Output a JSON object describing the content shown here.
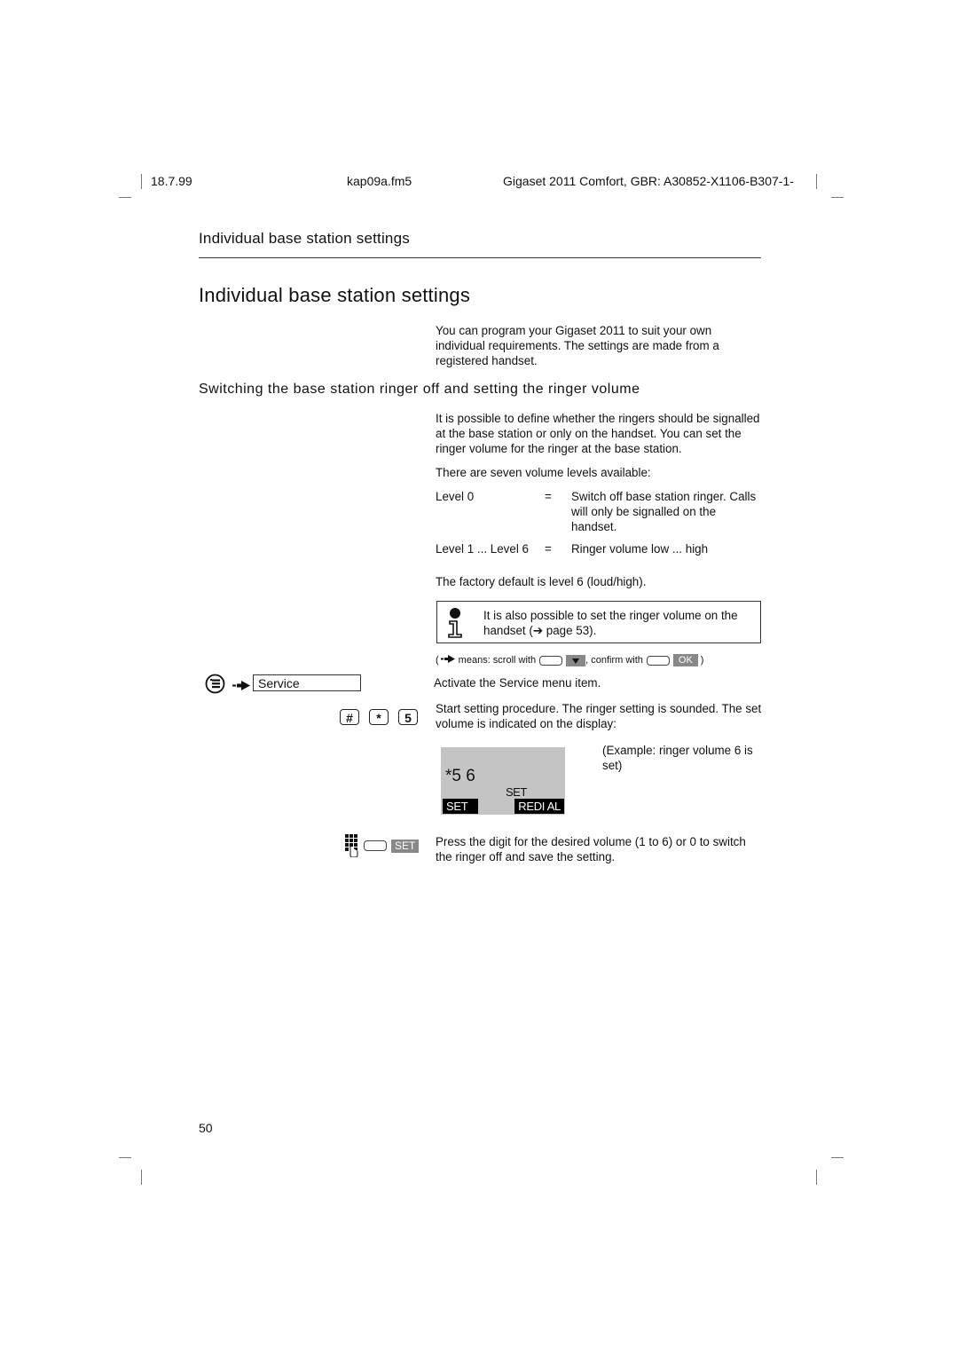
{
  "header": {
    "date": "18.7.99",
    "file": "kap09a.fm5",
    "product": "Gigaset 2011 Comfort, GBR: A30852-X1106-B307-1-"
  },
  "running_title": "Individual base station settings",
  "section_title": "Individual base station settings",
  "intro": "You can program your Gigaset 2011 to suit your own individual requirements. The settings are made from a registered handset.",
  "subsection_title": "Switching the base station ringer off and setting the ringer volume",
  "subsection_intro": "It is possible to define whether the ringers should be signalled at the base station or only on the handset. You can set the ringer volume for the ringer at the base station.",
  "levels_intro": "There are seven volume levels available:",
  "levels": [
    {
      "key": "Level 0",
      "eq": "=",
      "value": "Switch off base station ringer. Calls will only be signalled on the handset."
    },
    {
      "key": "Level 1 ... Level 6",
      "eq": "=",
      "value": "Ringer volume low ... high"
    }
  ],
  "factory_default": "The factory default is level 6 (loud/high).",
  "note": {
    "icon": "info-icon",
    "text": "It is also possible to set the ringer volume on the handset (➔ page 53)."
  },
  "legend": {
    "open_paren": "(",
    "means": "means: scroll with",
    "confirm": ", confirm with",
    "ok_label": "OK",
    "close_paren": ")"
  },
  "steps": [
    {
      "keys": [
        "menu-key-icon",
        "arrow-icon"
      ],
      "menu_item": "Service",
      "text": "Activate the Service menu item."
    },
    {
      "keys": [
        "#",
        "*",
        "5"
      ],
      "text": "Start setting procedure. The ringer setting is sounded. The set volume is indicated on the display:"
    },
    {
      "keys": [
        "keypad-icon",
        "softkey-blank",
        "SET"
      ],
      "text": "Press the digit for the desired volume (1 to 6) or 0 to switch the ringer off and save the setting."
    }
  ],
  "display": {
    "line1": "*5 6",
    "line2": "SET",
    "softkey_left": "SET",
    "softkey_right": "REDI AL",
    "caption": "(Example: ringer volume 6 is set)"
  },
  "page_number": "50"
}
